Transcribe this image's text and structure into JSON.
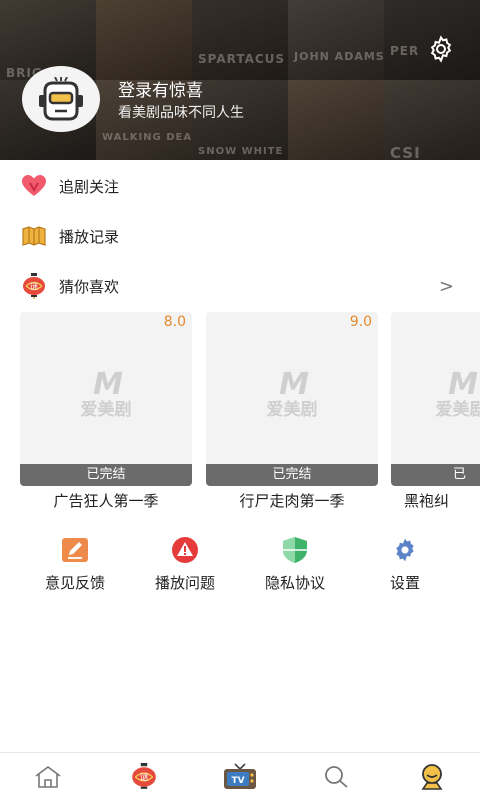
{
  "banner": {
    "posters": [
      "BRIG",
      "",
      "SPARTACUS",
      "JOHN ADAMS",
      "PER",
      "",
      "WALKING DEAD",
      "SNOW WHITE",
      "",
      "CSI"
    ],
    "login_title": "登录有惊喜",
    "login_subtitle": "看美剧品味不同人生"
  },
  "menu": [
    {
      "label": "追剧关注",
      "icon": "heart-ribbon-icon"
    },
    {
      "label": "播放记录",
      "icon": "film-reel-icon"
    },
    {
      "label": "猜你喜欢",
      "icon": "lantern-icon",
      "chevron": ">"
    }
  ],
  "recommend": {
    "logo_text": "爱美剧",
    "cards": [
      {
        "score": "8.0",
        "status": "已完结",
        "title": "广告狂人第一季"
      },
      {
        "score": "9.0",
        "status": "已完结",
        "title": "行尸走肉第一季"
      },
      {
        "score": "",
        "status": "已",
        "title": "黑袍纠"
      }
    ]
  },
  "actions": [
    {
      "label": "意见反馈",
      "icon": "feedback-pencil-icon",
      "color": "#e8894a"
    },
    {
      "label": "播放问题",
      "icon": "warning-icon",
      "color": "#e53b3b"
    },
    {
      "label": "隐私协议",
      "icon": "shield-icon",
      "color": "#3fb36a"
    },
    {
      "label": "设置",
      "icon": "gear-icon",
      "color": "#5b84c8"
    }
  ],
  "tabs": [
    {
      "name": "home-tab",
      "icon": "house-icon"
    },
    {
      "name": "guess-tab",
      "icon": "lantern-icon"
    },
    {
      "name": "tv-tab",
      "icon": "tv-icon",
      "badge": "TV"
    },
    {
      "name": "search-tab",
      "icon": "search-icon"
    },
    {
      "name": "profile-tab",
      "icon": "profile-icon",
      "active": true
    }
  ]
}
